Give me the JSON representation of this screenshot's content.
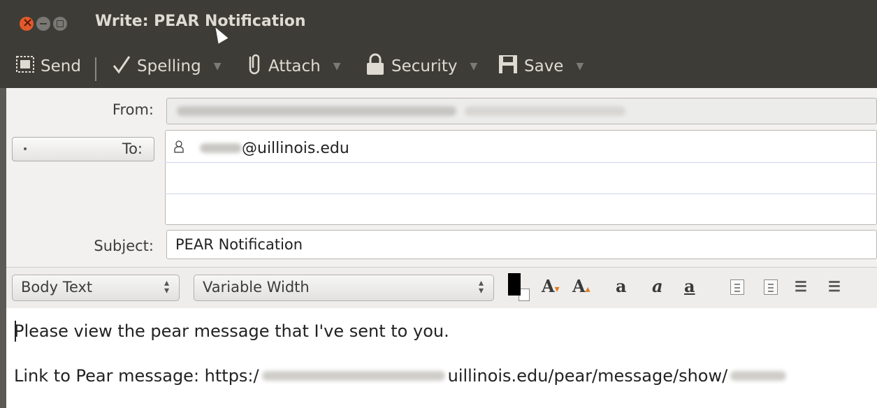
{
  "window": {
    "title": "Write: PEAR Notification"
  },
  "toolbar": {
    "items": [
      {
        "label": "Send",
        "icon": "send-icon"
      },
      {
        "label": "Spelling",
        "icon": "check-icon",
        "has_dropdown": true
      },
      {
        "label": "Attach",
        "icon": "paperclip-icon",
        "has_dropdown": true
      },
      {
        "label": "Security",
        "icon": "lock-icon",
        "has_dropdown": true
      },
      {
        "label": "Save",
        "icon": "floppy-disk-icon",
        "has_dropdown": true
      }
    ]
  },
  "header": {
    "from_label": "From:",
    "to_label": "To:",
    "to_value_suffix": "@uillinois.edu",
    "subject_label": "Subject:",
    "subject_value": "PEAR Notification"
  },
  "format_bar": {
    "paragraph_style": "Body Text",
    "font": "Variable Width",
    "text_color": "#000000",
    "background_color": "#ffffff"
  },
  "body": {
    "line1": "Please view the pear message that I've sent to you.",
    "line2_prefix": "Link to Pear message: https:/",
    "line2_middle": "uillinois.edu/pear/message/show/"
  },
  "colors": {
    "chrome": "#3d3c37",
    "close_button": "#e2592c"
  }
}
